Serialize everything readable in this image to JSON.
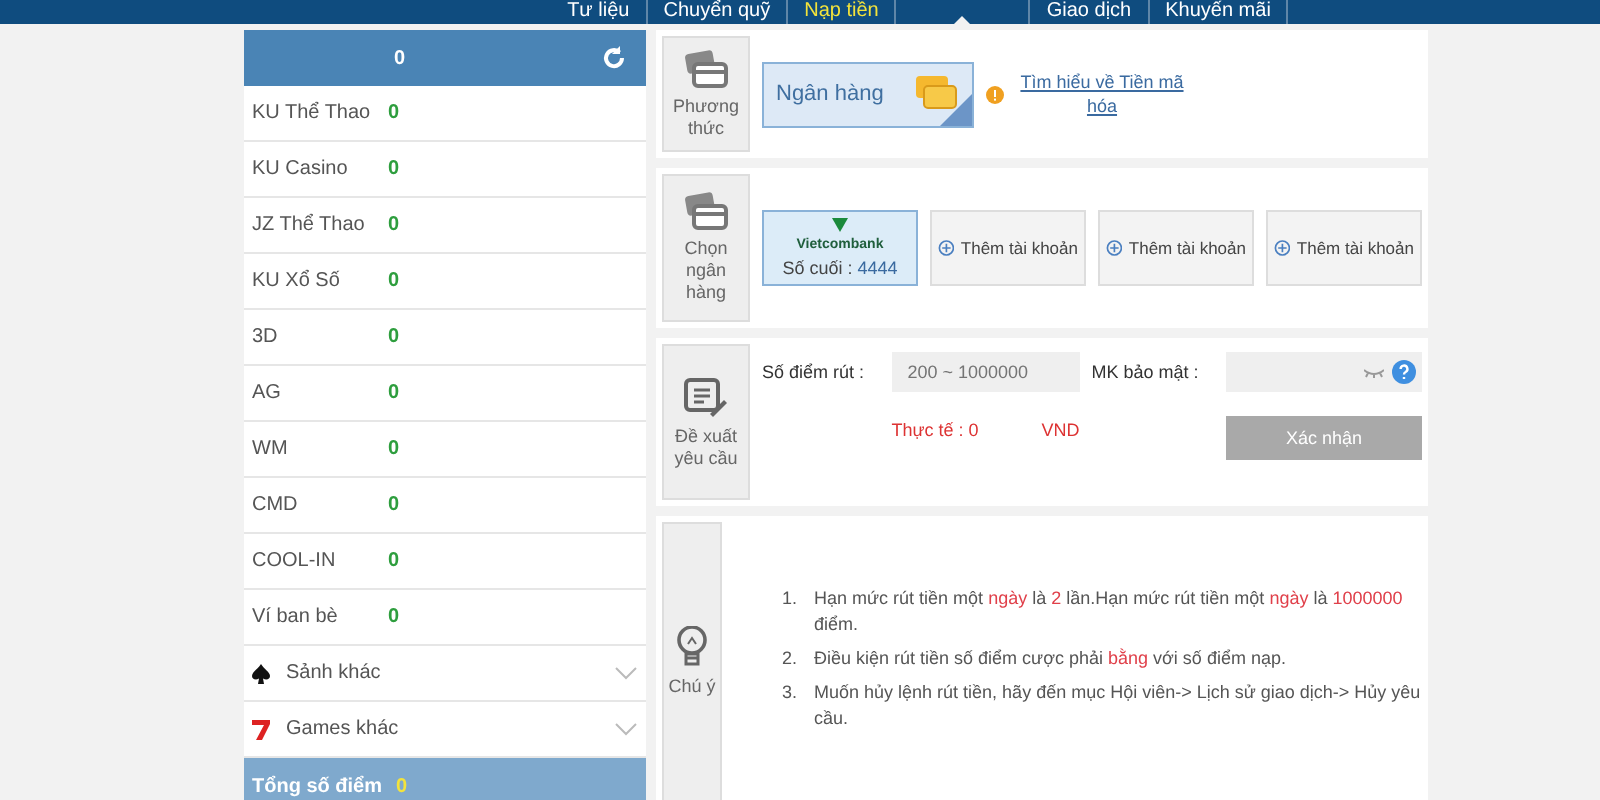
{
  "top_nav": [
    {
      "label": "Tư liệu",
      "selected": false,
      "highlighted": false
    },
    {
      "label": "Chuyển quỹ",
      "selected": false,
      "highlighted": false
    },
    {
      "label": "Nạp tiền",
      "selected": false,
      "highlighted": true
    },
    {
      "selected": true
    },
    {
      "label": "Giao dịch",
      "selected": false,
      "highlighted": false
    },
    {
      "label": "Khuyến mãi",
      "selected": false,
      "highlighted": false
    }
  ],
  "sidebar": {
    "header": {
      "value": "0"
    },
    "wallets": [
      {
        "name": "KU Thể Thao",
        "value": "0"
      },
      {
        "name": "KU Casino",
        "value": "0"
      },
      {
        "name": "JZ Thể Thao",
        "value": "0"
      },
      {
        "name": "KU Xổ Số",
        "value": "0"
      },
      {
        "name": "3D",
        "value": "0"
      },
      {
        "name": "AG",
        "value": "0"
      },
      {
        "name": "WM",
        "value": "0"
      },
      {
        "name": "CMD",
        "value": "0"
      },
      {
        "name": "COOL-IN",
        "value": "0"
      },
      {
        "name": "Ví ban bè",
        "value": "0"
      }
    ],
    "groups": [
      {
        "kind": "spade",
        "label": "Sảnh khác",
        "expanded": false
      },
      {
        "kind": "seven",
        "label": "Games khác",
        "expanded": false
      }
    ],
    "total": {
      "label": "Tổng số điểm",
      "value": "0"
    }
  },
  "method": {
    "label": "Phương thức",
    "options": [
      {
        "label": "Ngân hàng",
        "selected": true
      }
    ],
    "link": "Tìm hiểu về Tiền mã hóa"
  },
  "bank": {
    "label": "Chọn ngân hàng",
    "accounts": [
      {
        "kind": "account",
        "bank": "Vietcombank",
        "last_digits_label": "Số cuối :",
        "last_digits": "4444",
        "selected": true
      },
      {
        "kind": "add",
        "label": "Thêm tài khoản",
        "selected": false
      },
      {
        "kind": "add",
        "label": "Thêm tài khoản",
        "selected": false
      },
      {
        "kind": "add",
        "label": "Thêm tài khoản",
        "selected": false
      }
    ]
  },
  "request": {
    "label": "Đề xuất yêu cầu",
    "amount_label": "Số điểm rút :",
    "amount_placeholder": "200 ~ 1000000",
    "actual_label": "Thực tế : 0",
    "currency": "VND",
    "password_label": "MK bảo mật :",
    "submit": "Xác nhận",
    "submit_disabled": true
  },
  "notes": {
    "label": "Chú ý",
    "items": [
      {
        "number": "1.",
        "text": "Hạn mức rút tiền một **ngày** là **2** lần.Hạn mức rút tiền một **ngày** là **1000000** điểm."
      },
      {
        "number": "2.",
        "text": "Điều kiện rút tiền số điểm cược phải **bằng** với số điểm nạp."
      },
      {
        "number": "3.",
        "text": "Muốn hủy lệnh rút tiền, hãy đến mục Hội viên-> Lịch sử giao dịch-> Hủy yêu cầu."
      }
    ]
  }
}
